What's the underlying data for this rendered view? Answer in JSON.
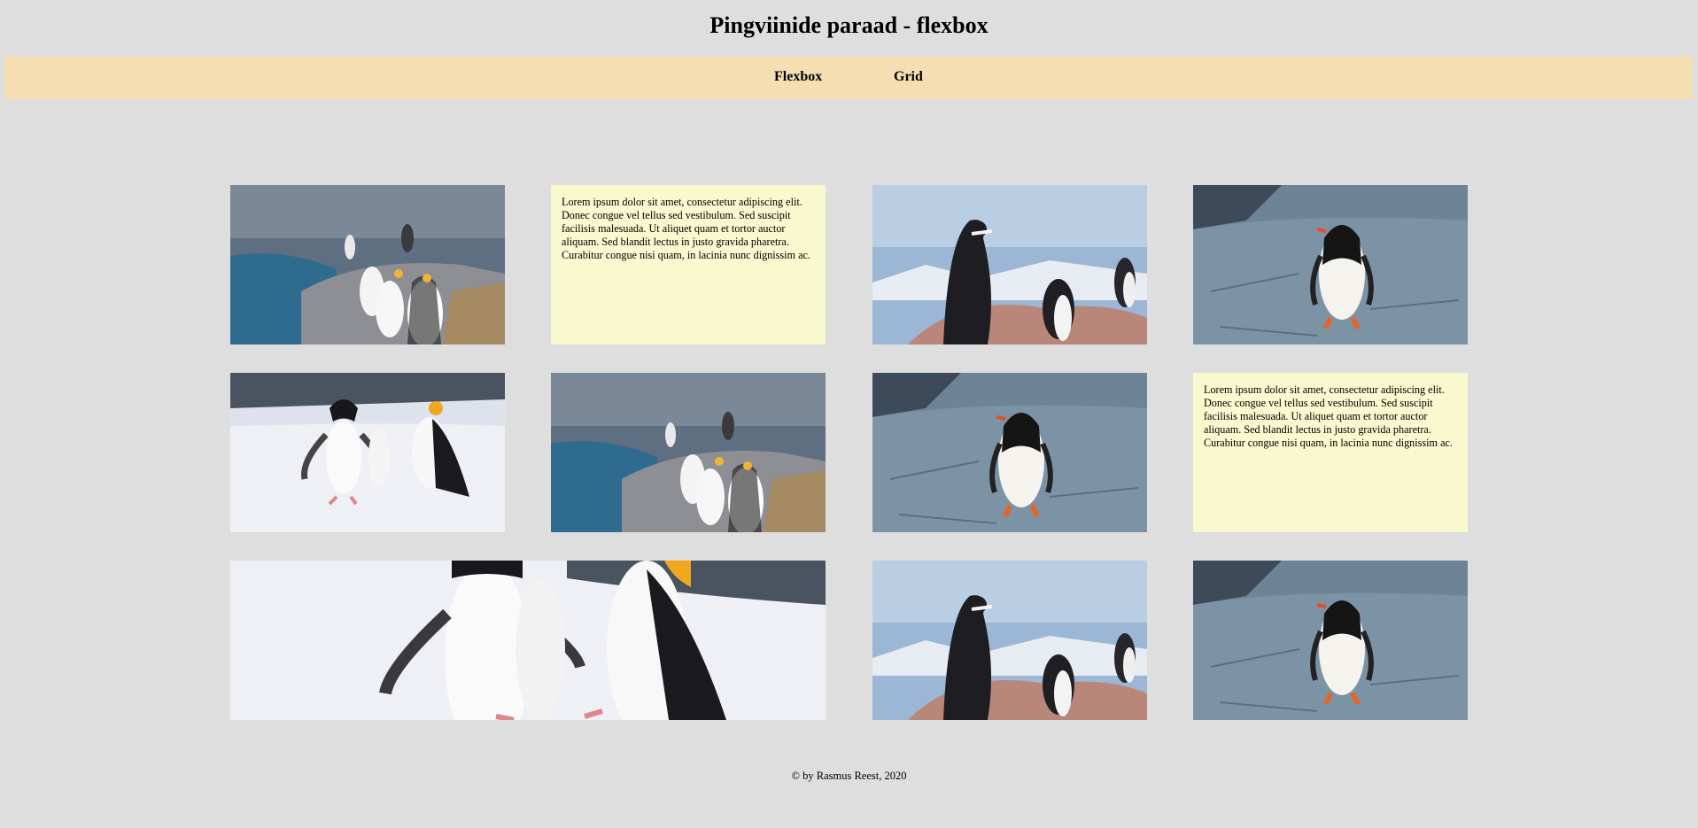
{
  "page": {
    "title": "Pingviinide paraad - flexbox"
  },
  "nav": {
    "items": [
      {
        "label": "Flexbox"
      },
      {
        "label": "Grid"
      }
    ]
  },
  "gallery": {
    "lorem": "Lorem ipsum dolor sit amet, consectetur adipiscing elit. Donec congue vel tellus sed vestibulum. Sed suscipit facilisis malesuada. Ut aliquet quam et tortor auctor aliquam. Sed blandit lectus in justo gravida pharetra. Curabitur congue nisi quam, in lacinia nunc dignissim ac.",
    "tiles": [
      {
        "kind": "image",
        "subject": "king-penguins-on-rocks-by-water"
      },
      {
        "kind": "text"
      },
      {
        "kind": "image",
        "subject": "chinstrap-penguins-on-pink-rocks"
      },
      {
        "kind": "image",
        "subject": "gentoo-penguin-on-grey-rock"
      },
      {
        "kind": "image",
        "subject": "chinstrap-penguins-on-snow"
      },
      {
        "kind": "image",
        "subject": "king-penguins-on-rocks-by-water"
      },
      {
        "kind": "image",
        "subject": "gentoo-penguin-on-grey-rock"
      },
      {
        "kind": "text"
      },
      {
        "kind": "image",
        "subject": "chinstrap-penguins-on-snow-closeup",
        "wide": true
      },
      {
        "kind": "image",
        "subject": "chinstrap-penguins-on-pink-rocks"
      },
      {
        "kind": "image",
        "subject": "gentoo-penguin-on-grey-rock"
      }
    ]
  },
  "colors": {
    "background": "#dedede",
    "nav": "#f6deb3",
    "text_tile": "#f9f8cf"
  },
  "footer": {
    "text": "© by Rasmus Reest, 2020"
  }
}
